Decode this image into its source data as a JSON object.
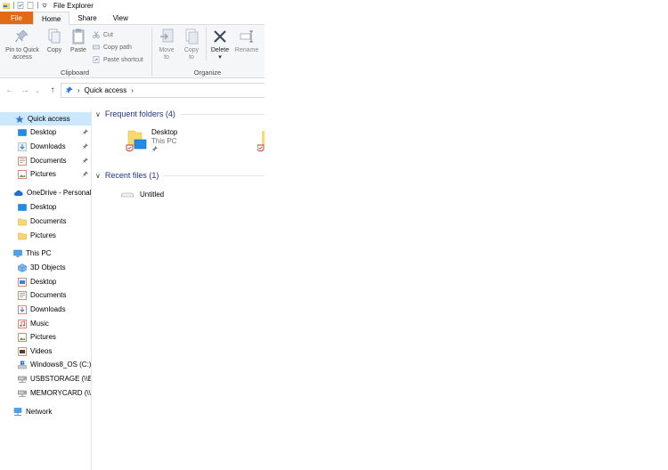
{
  "window": {
    "title": "File Explorer"
  },
  "ribbon": {
    "tabs": [
      {
        "label": "File"
      },
      {
        "label": "Home"
      },
      {
        "label": "Share"
      },
      {
        "label": "View"
      }
    ],
    "clipboard": {
      "label": "Clipboard",
      "pin_line1": "Pin to Quick",
      "pin_line2": "access",
      "copy": "Copy",
      "paste": "Paste",
      "cut": "Cut",
      "copy_path": "Copy path",
      "paste_shortcut": "Paste shortcut"
    },
    "organize": {
      "label": "Organize",
      "move_line1": "Move",
      "move_line2": "to",
      "copy_line1": "Copy",
      "copy_line2": "to",
      "delete": "Delete",
      "rename": "Rename"
    }
  },
  "address": {
    "crumb": "Quick access"
  },
  "nav": {
    "quick_access": "Quick access",
    "qa_desktop": "Desktop",
    "qa_downloads": "Downloads",
    "qa_documents": "Documents",
    "qa_pictures": "Pictures",
    "onedrive": "OneDrive - Personal",
    "od_desktop": "Desktop",
    "od_documents": "Documents",
    "od_pictures": "Pictures",
    "this_pc": "This PC",
    "pc_3d": "3D Objects",
    "pc_desktop": "Desktop",
    "pc_documents": "Documents",
    "pc_downloads": "Downloads",
    "pc_music": "Music",
    "pc_pictures": "Pictures",
    "pc_videos": "Videos",
    "drive_c": "Windows8_OS (C:)",
    "usbstorage": "USBSTORAGE (\\\\EPS",
    "memorycard": "MEMORYCARD (\\\\E",
    "network": "Network"
  },
  "content": {
    "frequent_header": "Frequent folders (4)",
    "recent_header": "Recent files (1)",
    "tile_name": "Desktop",
    "tile_sub": "This PC",
    "recent_file": "Untitled"
  },
  "colors": {
    "file_tab": "#e26a12",
    "selected": "#cce8ff",
    "header_blue": "#1e3287",
    "folder_yellow": "#f8d775",
    "pin_blue": "#2b79d0"
  }
}
